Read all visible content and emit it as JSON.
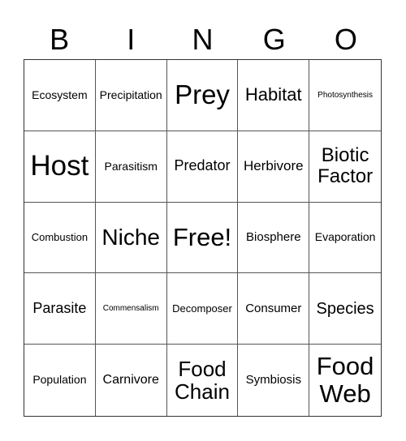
{
  "header": [
    "B",
    "I",
    "N",
    "G",
    "O"
  ],
  "cells": [
    "Ecosystem",
    "Precipitation",
    "Prey",
    "Habitat",
    "Photosynthesis",
    "Host",
    "Parasitism",
    "Predator",
    "Herbivore",
    "Biotic Factor",
    "Combustion",
    "Niche",
    "Free!",
    "Biosphere",
    "Evaporation",
    "Parasite",
    "Commensalism",
    "Decomposer",
    "Consumer",
    "Species",
    "Population",
    "Carnivore",
    "Food Chain",
    "Symbiosis",
    "Food Web"
  ]
}
